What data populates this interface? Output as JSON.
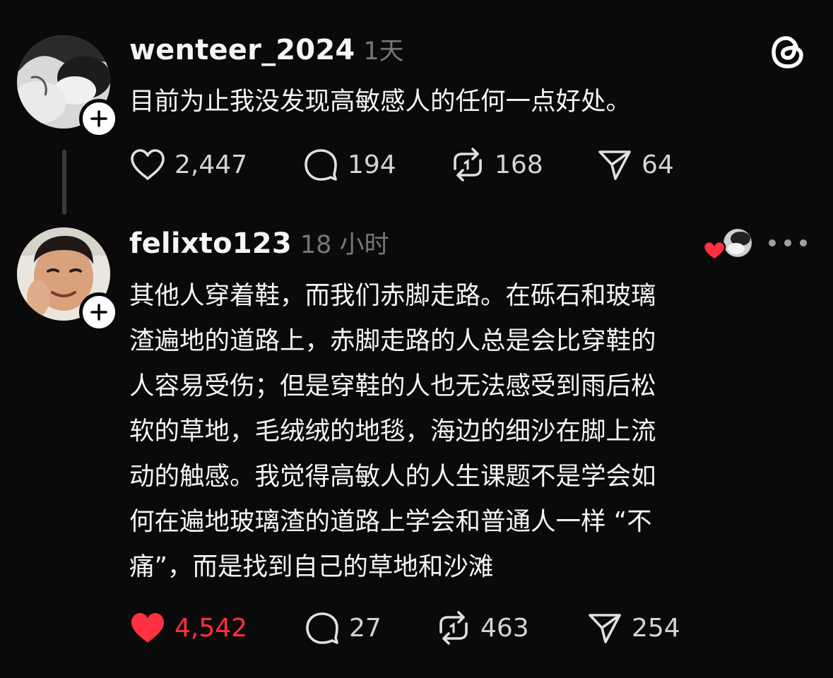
{
  "app": {
    "logo_icon": "threads-logo-icon"
  },
  "posts": [
    {
      "username": "wenteer_2024",
      "time": "1天",
      "text": "目前为止我没发现高敏感人的任何一点好处。",
      "likes": "2,447",
      "replies": "194",
      "reposts": "168",
      "shares": "64",
      "liked": false
    },
    {
      "username": "felixto123",
      "time": "18 小时",
      "text": "其他人穿着鞋，而我们赤脚走路。在砾石和玻璃\n渣遍地的道路上，赤脚走路的人总是会比穿鞋的\n人容易受伤；但是穿鞋的人也无法感受到雨后松\n软的草地，毛绒绒的地毯，海边的细沙在脚上流\n动的触感。我觉得高敏人的人生课题不是学会如\n何在遍地玻璃渣的道路上学会和普通人一样 “不\n痛”，而是找到自己的草地和沙滩",
      "likes": "4,542",
      "replies": "27",
      "reposts": "463",
      "shares": "254",
      "liked": true
    }
  ],
  "colors": {
    "background": "#0a0a0a",
    "text": "#f3f5f7",
    "muted": "#777777",
    "like_red": "#ff3040"
  }
}
